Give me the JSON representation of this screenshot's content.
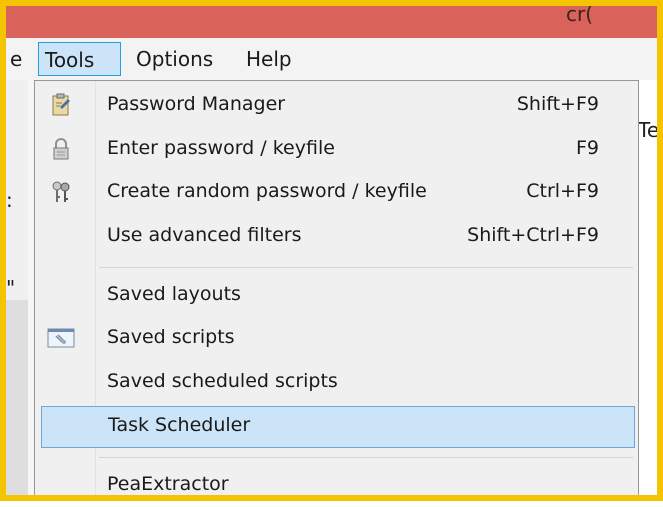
{
  "window": {
    "title_fragment": "cr("
  },
  "menubar": {
    "items": [
      {
        "label": "e"
      },
      {
        "label": "Tools"
      },
      {
        "label": "Options"
      },
      {
        "label": "Help"
      }
    ]
  },
  "background": {
    "left_fragment": ":",
    "left_fragment2": "\"",
    "right_fragment": "Te"
  },
  "tools_menu": {
    "items": [
      {
        "label": "Password Manager",
        "shortcut": "Shift+F9",
        "icon": "clipboard-icon"
      },
      {
        "label": "Enter password / keyfile",
        "shortcut": "F9",
        "icon": "lock-icon"
      },
      {
        "label": "Create random password / keyfile",
        "shortcut": "Ctrl+F9",
        "icon": "keys-icon"
      },
      {
        "label": "Use advanced filters",
        "shortcut": "Shift+Ctrl+F9"
      },
      {
        "label": "Saved layouts"
      },
      {
        "label": "Saved scripts",
        "icon": "script-icon"
      },
      {
        "label": "Saved scheduled scripts"
      },
      {
        "label": "Task Scheduler"
      },
      {
        "label": "PeaExtractor"
      }
    ]
  },
  "colors": {
    "titlebar": "#d9635b",
    "highlight": "#cce4f7",
    "frame": "#f5c400"
  }
}
